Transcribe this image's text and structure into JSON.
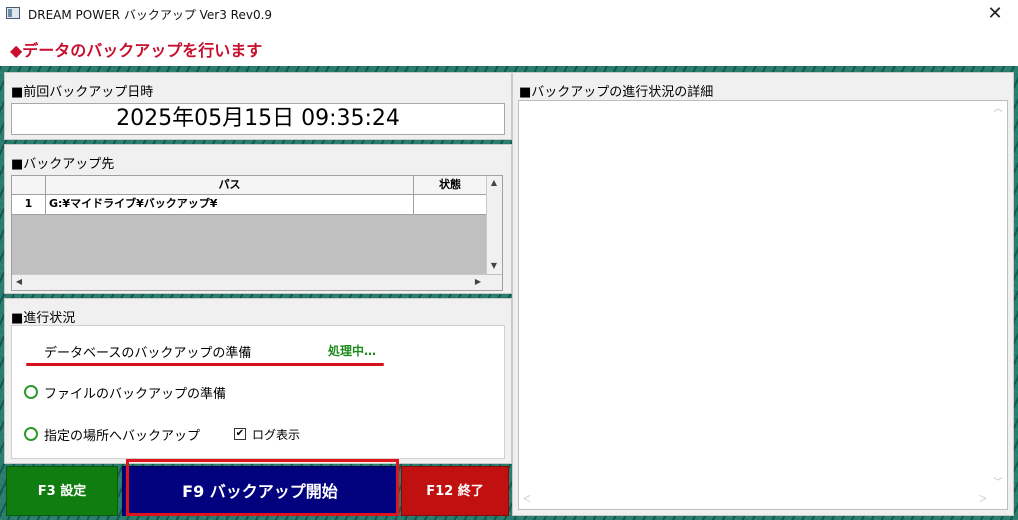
{
  "window": {
    "title": "DREAM POWER バックアップ Ver3 Rev0.9",
    "close": "✕"
  },
  "header": {
    "text": "◆データのバックアップを行います"
  },
  "last_backup": {
    "label": "■前回バックアップ日時",
    "value": "2025年05月15日 09:35:24"
  },
  "destination": {
    "label": "■バックアップ先",
    "columns": {
      "path": "パス",
      "status": "状態"
    },
    "rows": [
      {
        "num": "1",
        "path": "G:¥マイドライブ¥バックアップ¥",
        "status": ""
      }
    ]
  },
  "progress": {
    "label": "■進行状況",
    "steps": [
      {
        "label": "データベースのバックアップの準備",
        "state": "処理中…"
      },
      {
        "label": "ファイルのバックアップの準備"
      },
      {
        "label": "指定の場所へバックアップ"
      }
    ],
    "log": {
      "label": "ログ表示",
      "checked": true,
      "mark": "✔"
    }
  },
  "details": {
    "label": "■バックアップの進行状況の詳細"
  },
  "buttons": {
    "f3": {
      "label": "F3 設定",
      "color": "#0f7d0f"
    },
    "f9": {
      "label": "F9 バックアップ開始",
      "color": "#02027e"
    },
    "f12": {
      "label": "F12 終了",
      "color": "#c01010"
    }
  },
  "colors": {
    "accent_red": "#c8102e",
    "status_green": "#1d8a1d"
  }
}
